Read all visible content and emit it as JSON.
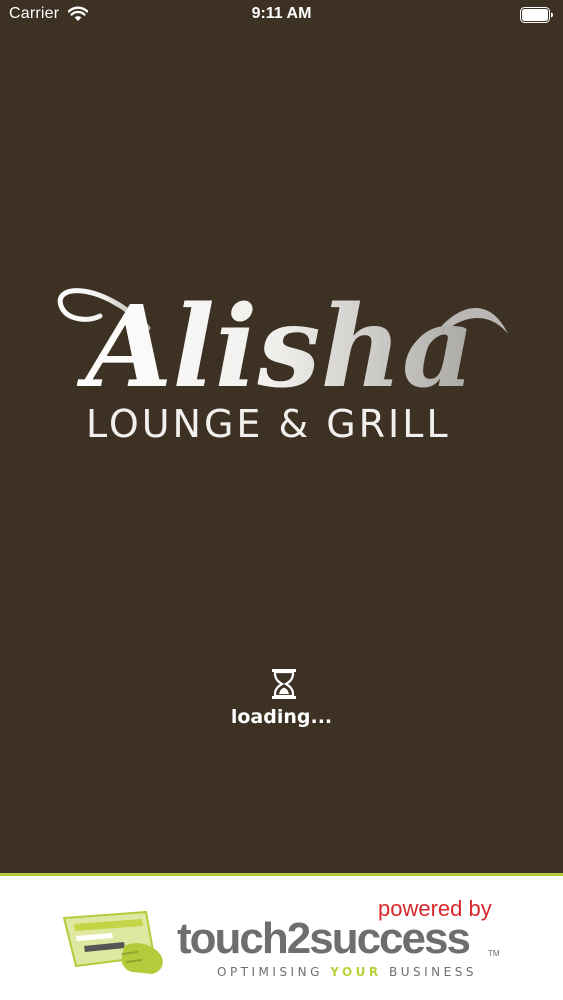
{
  "status_bar": {
    "carrier": "Carrier",
    "time": "9:11 AM",
    "icons": [
      "wifi-icon",
      "battery-icon"
    ]
  },
  "splash": {
    "background_color": "#3d3124",
    "logo": {
      "name": "Alisha",
      "subtitle": "LOUNGE & GRILL"
    },
    "loading_icon": "hourglass-icon",
    "loading_text": "loading..."
  },
  "footer": {
    "accent_color": "#b6cb3b",
    "powered_by": "powered by",
    "brand": "touch2success",
    "trademark": "TM",
    "tagline_before": "OPTIMISING ",
    "tagline_highlight": "YOUR",
    "tagline_after": " BUSINESS",
    "brand_icon": "card-terminal-icon"
  }
}
